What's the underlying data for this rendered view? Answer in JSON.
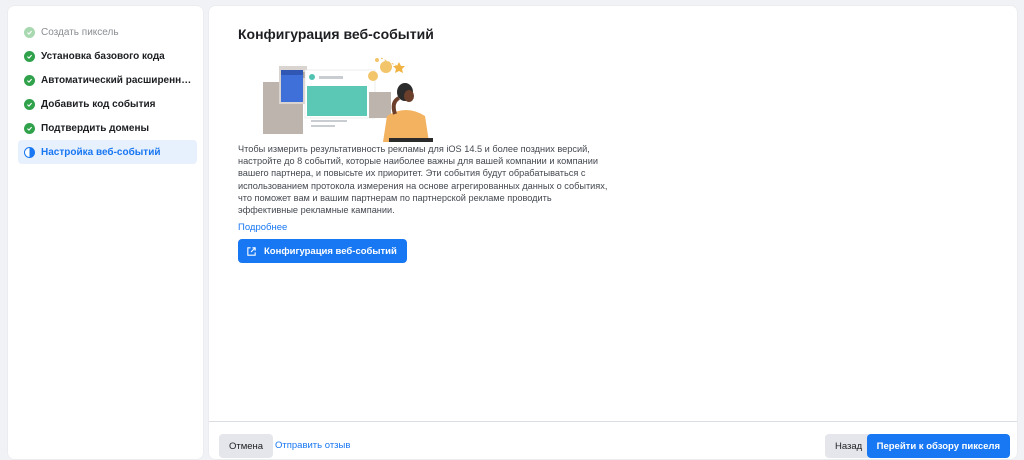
{
  "sidebar": {
    "steps": [
      {
        "label": "Создать пиксель",
        "state": "done-light"
      },
      {
        "label": "Установка базового кода",
        "state": "done"
      },
      {
        "label": "Автоматический расширенный п...",
        "state": "done"
      },
      {
        "label": "Добавить код события",
        "state": "done"
      },
      {
        "label": "Подтвердить домены",
        "state": "done"
      },
      {
        "label": "Настройка веб-событий",
        "state": "active"
      }
    ]
  },
  "main": {
    "title": "Конфигурация веб-событий",
    "description": "Чтобы измерить результативность рекламы для iOS 14.5 и более поздних версий, настройте до 8 событий, которые наиболее важны для вашей компании и компании вашего партнера, и повысьте их приоритет. Эти события будут обрабатываться с использованием протокола измерения на основе агрегированных данных о событиях, что поможет вам и вашим партнерам по партнерской рекламе проводить эффективные рекламные кампании.",
    "learn_more": "Подробнее",
    "configure_button": "Конфигурация веб-событий"
  },
  "footer": {
    "cancel": "Отмена",
    "feedback": "Отправить отзыв",
    "back": "Назад",
    "next": "Перейти к обзору пикселя"
  },
  "colors": {
    "accent": "#1877f2",
    "success": "#31a24c",
    "active_bg": "#e7f0fd"
  },
  "icons": {
    "done": "check-circle-icon",
    "active": "half-circle-icon",
    "external": "external-link-icon"
  }
}
